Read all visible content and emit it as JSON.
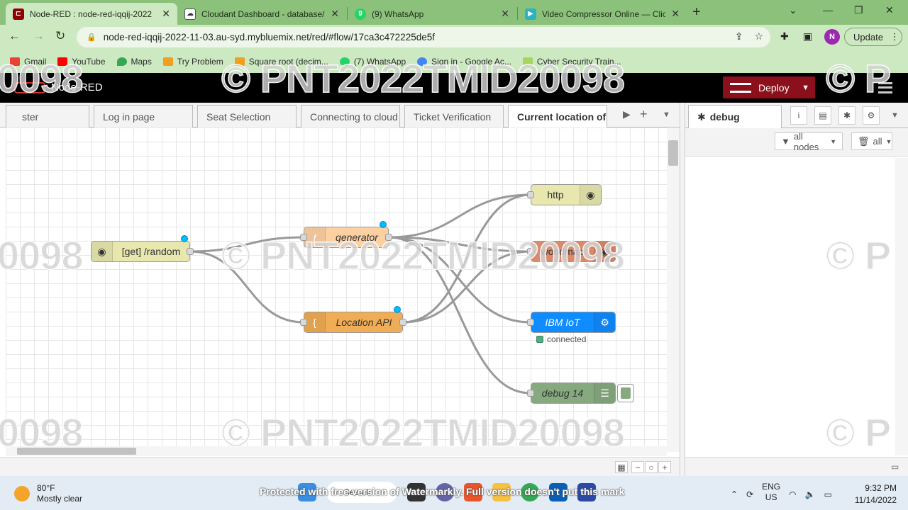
{
  "browser": {
    "tabs": [
      {
        "title": "Node-RED : node-red-iqqij-2022",
        "active": true
      },
      {
        "title": "Cloudant Dashboard - database/",
        "active": false
      },
      {
        "title": "(9) WhatsApp",
        "active": false
      },
      {
        "title": "Video Compressor Online — Clic",
        "active": false
      }
    ],
    "url": "node-red-iqqij-2022-11-03.au-syd.mybluemix.net/red/#flow/17ca3c472225de5f",
    "profile_initial": "N",
    "update_label": "Update",
    "bookmarks": [
      "Gmail",
      "YouTube",
      "Maps",
      "Try Problem",
      "Square root (decim...",
      "(7) WhatsApp",
      "Sign in - Google Ac...",
      "Cyber Security Train..."
    ]
  },
  "nodered": {
    "brand": "Node-RED",
    "deploy_label": "Deploy",
    "flow_tabs": [
      "ster",
      "Log in page",
      "Seat Selection",
      "Connecting to cloud",
      "Ticket Verification",
      "Current location of"
    ],
    "nodes": {
      "get_random": "[get] /random",
      "generator": "generator",
      "location_api": "Location API",
      "http": "http",
      "worldmap": "worldmap",
      "ibm_iot": "IBM IoT",
      "ibm_iot_status": "connected",
      "debug14": "debug 14"
    },
    "sidebar": {
      "tab": "debug",
      "filter_nodes": "all nodes",
      "filter_all": "all"
    }
  },
  "watermark": {
    "main": "© PNT2022TMID20098",
    "fragment_left": "0098",
    "fragment_right": "© P",
    "bottom": "Protected with free version of Watermarkly. Full version doesn't put this mark"
  },
  "taskbar": {
    "temp": "80°F",
    "condition": "Mostly clear",
    "search": "Search",
    "lang1": "ENG",
    "lang2": "US",
    "time": "9:32 PM",
    "date": "11/14/2022"
  }
}
